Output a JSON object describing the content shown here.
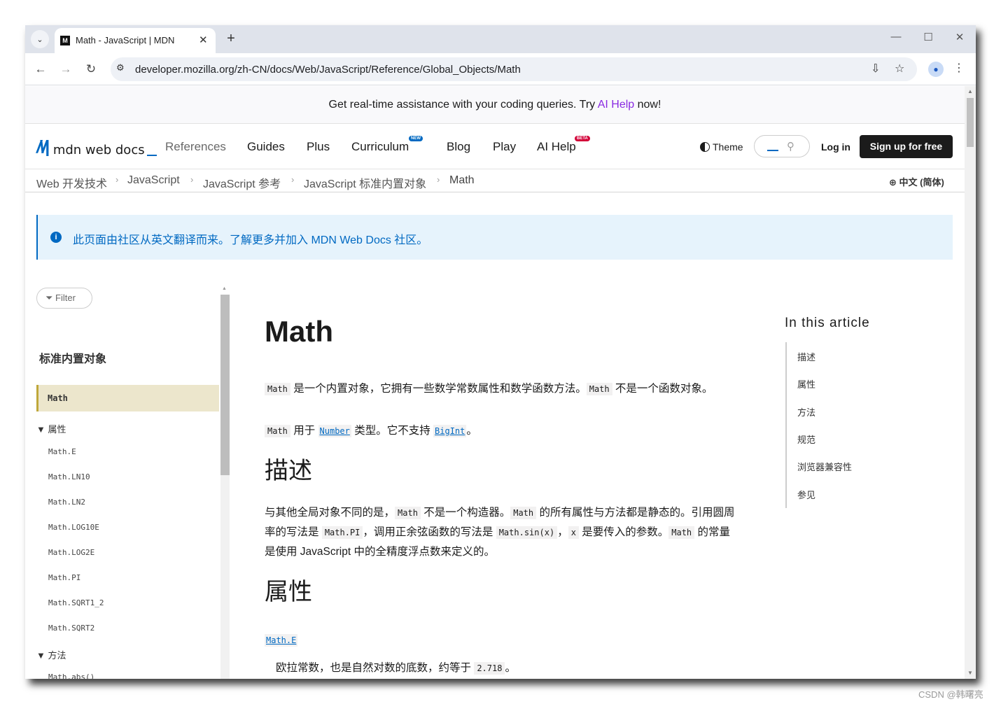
{
  "browser": {
    "tab_title": "Math - JavaScript | MDN",
    "tab_favicon": "M",
    "url": "developer.mozilla.org/zh-CN/docs/Web/JavaScript/Reference/Global_Objects/Math"
  },
  "promo": {
    "text_before": "Get real-time assistance with your coding queries. Try ",
    "link": "AI Help",
    "text_after": " now!"
  },
  "header": {
    "logo_text": "mdn web docs",
    "nav": [
      {
        "label": "References"
      },
      {
        "label": "Guides"
      },
      {
        "label": "Plus"
      },
      {
        "label": "Curriculum",
        "badge": "NEW"
      },
      {
        "label": "Blog"
      },
      {
        "label": "Play"
      },
      {
        "label": "AI Help",
        "badge": "BETA"
      }
    ],
    "theme": "Theme",
    "login": "Log in",
    "signup": "Sign up for free"
  },
  "breadcrumb": [
    "Web 开发技术",
    "JavaScript",
    "JavaScript 参考",
    "JavaScript 标准内置对象",
    "Math"
  ],
  "language": "中文 (简体)",
  "notice": "此页面由社区从英文翻译而来。了解更多并加入 MDN Web Docs 社区。",
  "sidebar": {
    "filter_placeholder": "Filter",
    "title": "标准内置对象",
    "active": "Math",
    "group_properties": "▼ 属性",
    "properties": [
      "Math.E",
      "Math.LN10",
      "Math.LN2",
      "Math.LOG10E",
      "Math.LOG2E",
      "Math.PI",
      "Math.SQRT1_2",
      "Math.SQRT2"
    ],
    "group_methods": "▼ 方法",
    "methods": [
      "Math.abs()"
    ]
  },
  "article": {
    "title": "Math",
    "p1": {
      "c1": "Math",
      "t1": " 是一个内置对象，它拥有一些数学常数属性和数学函数方法。",
      "c2": "Math",
      "t2": " 不是一个函数对象。"
    },
    "p2": {
      "c1": "Math",
      "t1": " 用于 ",
      "l1": "Number",
      "t2": " 类型。它不支持 ",
      "l2": "BigInt",
      "t3": "。"
    },
    "h_desc": "描述",
    "desc_l1": {
      "t1": "与其他全局对象不同的是，",
      "c1": "Math",
      "t2": " 不是一个构造器。",
      "c2": "Math",
      "t3": " 的所有属性与方法都是静态的。引用圆周"
    },
    "desc_l2": {
      "t1": "率的写法是 ",
      "c1": "Math.PI",
      "t2": "，调用正余弦函数的写法是 ",
      "c2": "Math.sin(x)",
      "t3": "，",
      "c3": "x",
      "t4": " 是要传入的参数。",
      "c4": "Math",
      "t5": " 的常量"
    },
    "desc_l3": "是使用 JavaScript 中的全精度浮点数来定义的。",
    "h_props": "属性",
    "prop_link": "Math.E",
    "prop_desc": {
      "t1": "欧拉常数，也是自然对数的底数，约等于 ",
      "c1": "2.718",
      "t2": "。"
    }
  },
  "toc": {
    "title": "In this article",
    "items": [
      "描述",
      "属性",
      "方法",
      "规范",
      "浏览器兼容性",
      "参见"
    ]
  },
  "watermark": "CSDN @韩曙亮"
}
